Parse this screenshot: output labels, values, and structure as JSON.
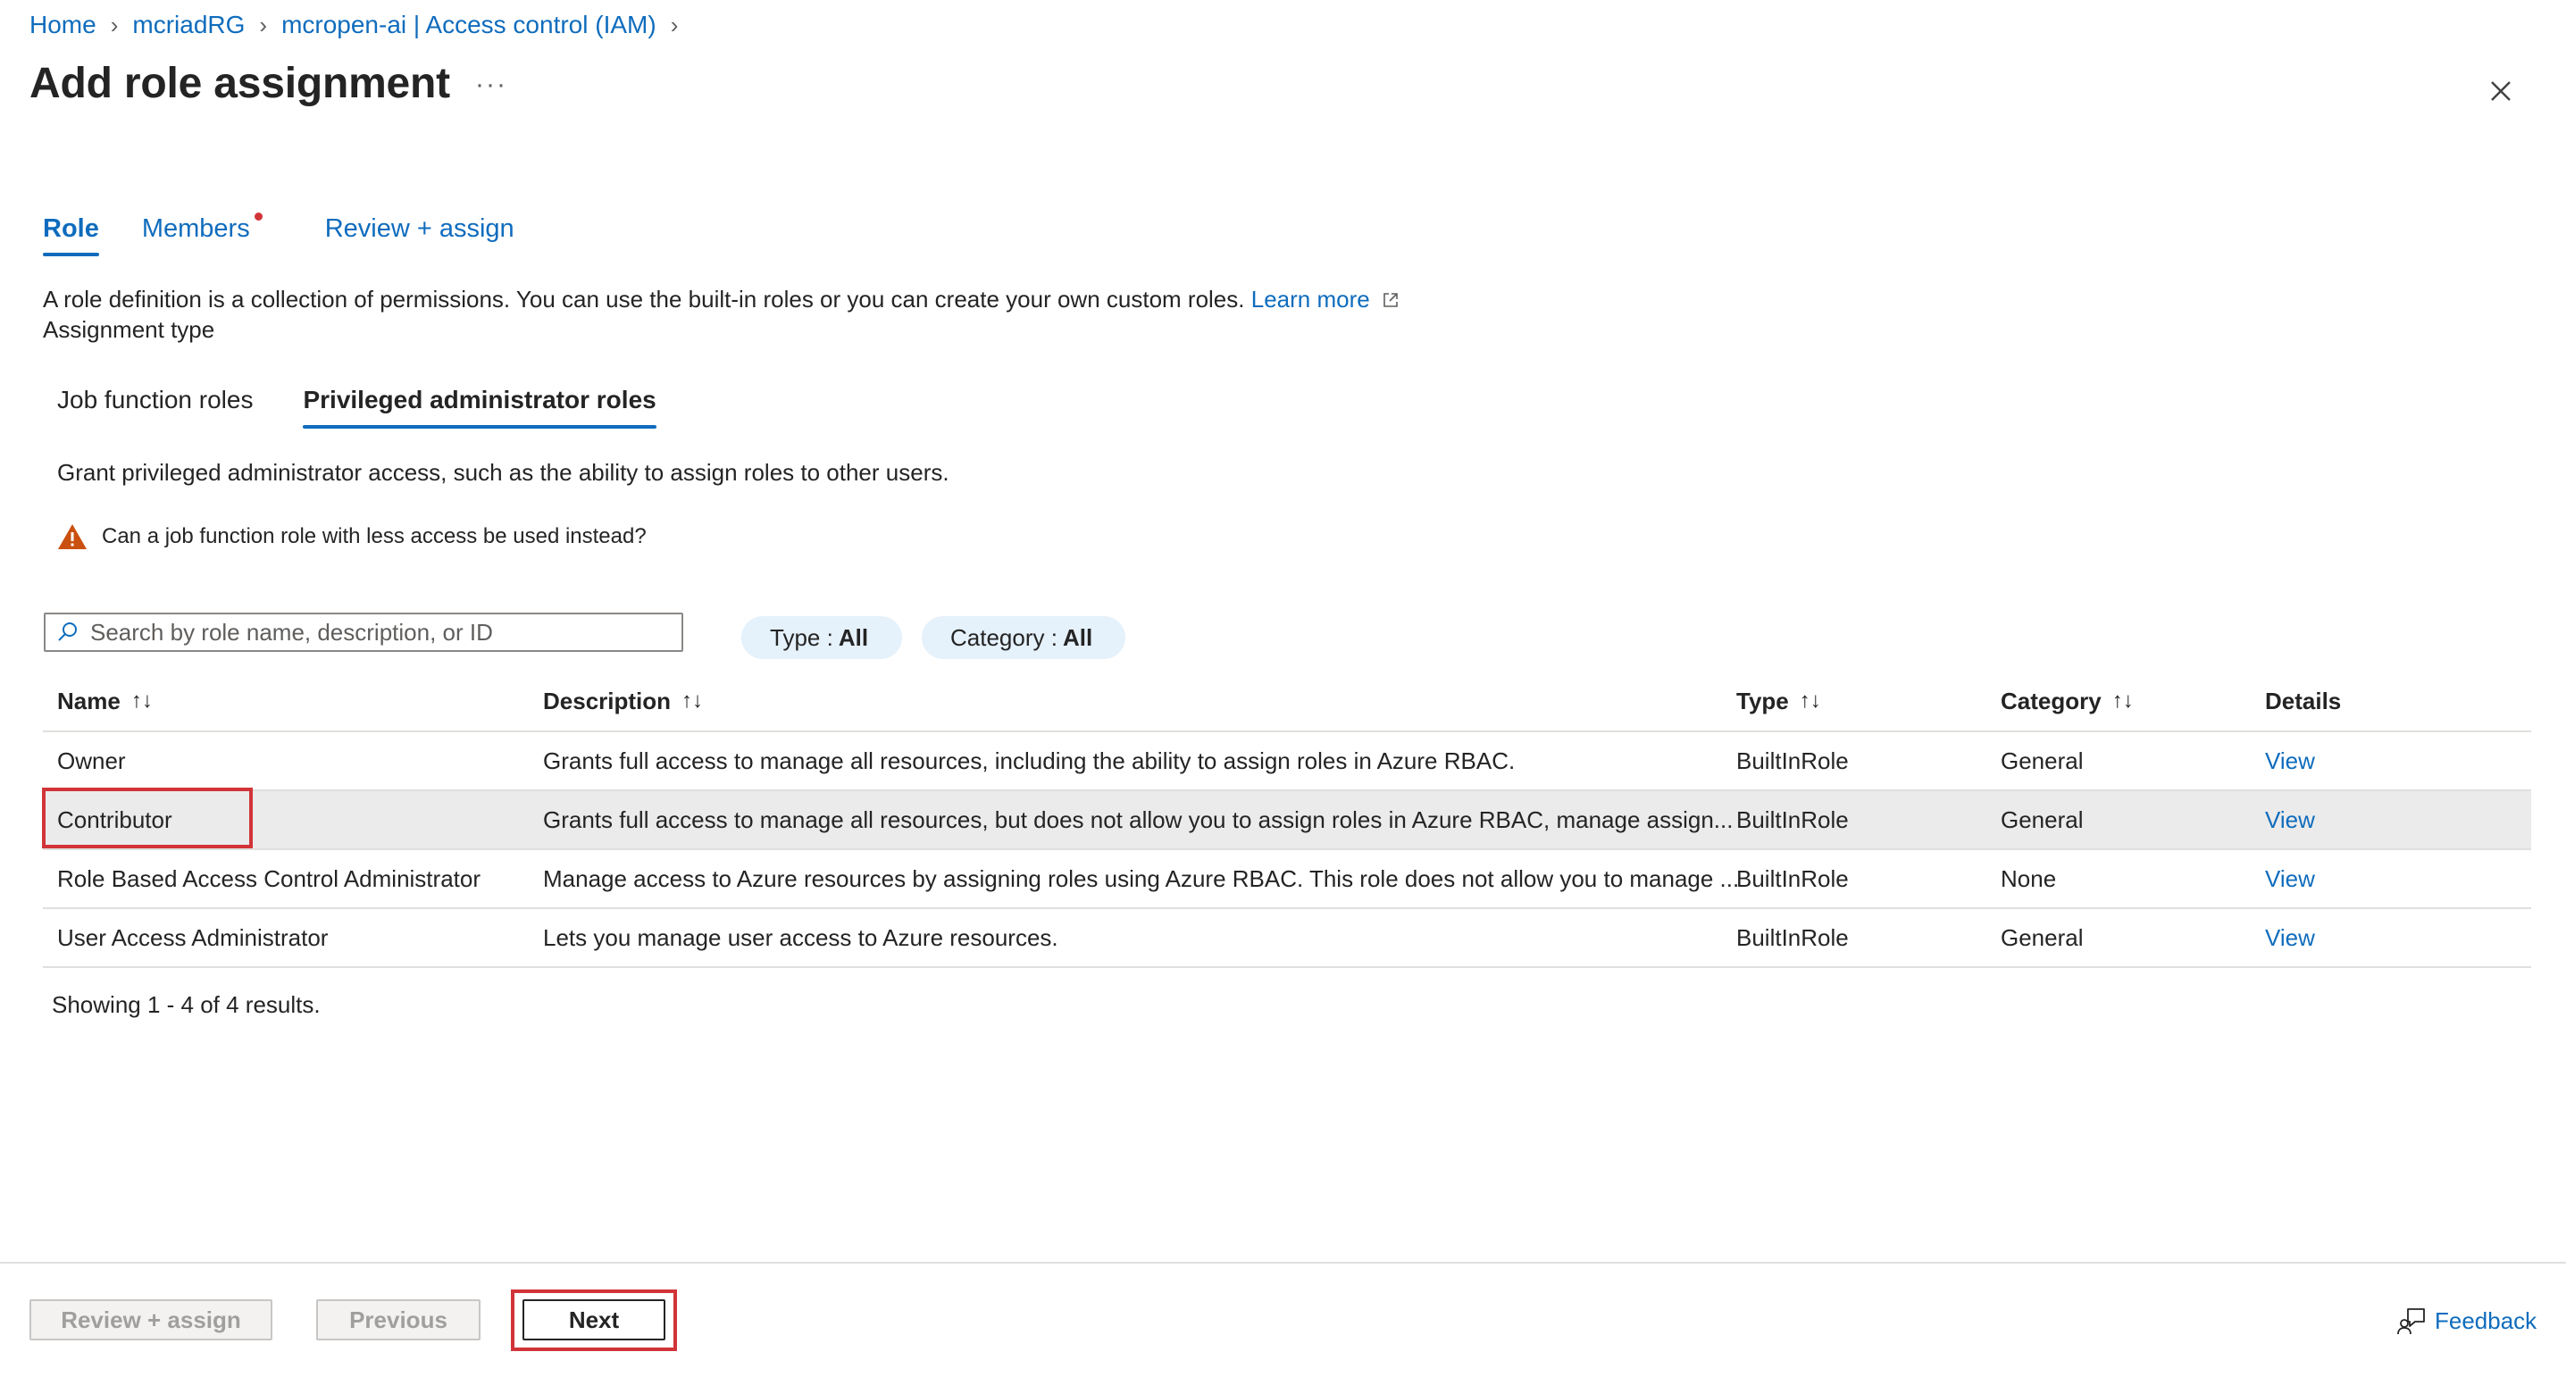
{
  "breadcrumb": {
    "items": [
      "Home",
      "mcriadRG",
      "mcropen-ai | Access control (IAM)"
    ]
  },
  "page": {
    "title": "Add role assignment",
    "more": "···"
  },
  "tabs": [
    {
      "label": "Role"
    },
    {
      "label": "Members"
    },
    {
      "label": "Review + assign"
    }
  ],
  "intro": {
    "text": "A role definition is a collection of permissions. You can use the built-in roles or you can create your own custom roles.",
    "learn_more": "Learn more",
    "assignment_type": "Assignment type"
  },
  "subtabs": [
    {
      "label": "Job function roles"
    },
    {
      "label": "Privileged administrator roles"
    }
  ],
  "privileged": {
    "description": "Grant privileged administrator access, such as the ability to assign roles to other users.",
    "warning": "Can a job function role with less access be used instead?"
  },
  "search": {
    "placeholder": "Search by role name, description, or ID",
    "value": ""
  },
  "filters": {
    "type_label": "Type : ",
    "type_value": "All",
    "category_label": "Category : ",
    "category_value": "All"
  },
  "table": {
    "columns": {
      "name": "Name",
      "description": "Description",
      "type": "Type",
      "category": "Category",
      "details": "Details"
    },
    "rows": [
      {
        "name": "Owner",
        "description": "Grants full access to manage all resources, including the ability to assign roles in Azure RBAC.",
        "type": "BuiltInRole",
        "category": "General",
        "details": "View"
      },
      {
        "name": "Contributor",
        "description": "Grants full access to manage all resources, but does not allow you to assign roles in Azure RBAC, manage assign...",
        "type": "BuiltInRole",
        "category": "General",
        "details": "View"
      },
      {
        "name": "Role Based Access Control Administrator",
        "description": "Manage access to Azure resources by assigning roles using Azure RBAC. This role does not allow you to manage ...",
        "type": "BuiltInRole",
        "category": "None",
        "details": "View"
      },
      {
        "name": "User Access Administrator",
        "description": "Lets you manage user access to Azure resources.",
        "type": "BuiltInRole",
        "category": "General",
        "details": "View"
      }
    ],
    "result_count": "Showing 1 - 4 of 4 results."
  },
  "footer": {
    "review_assign": "Review + assign",
    "previous": "Previous",
    "next": "Next",
    "feedback": "Feedback"
  },
  "colors": {
    "accent": "#0f6cbd",
    "highlight": "#d13438",
    "warning": "#ca5010",
    "selected_row": "#ebebeb"
  }
}
